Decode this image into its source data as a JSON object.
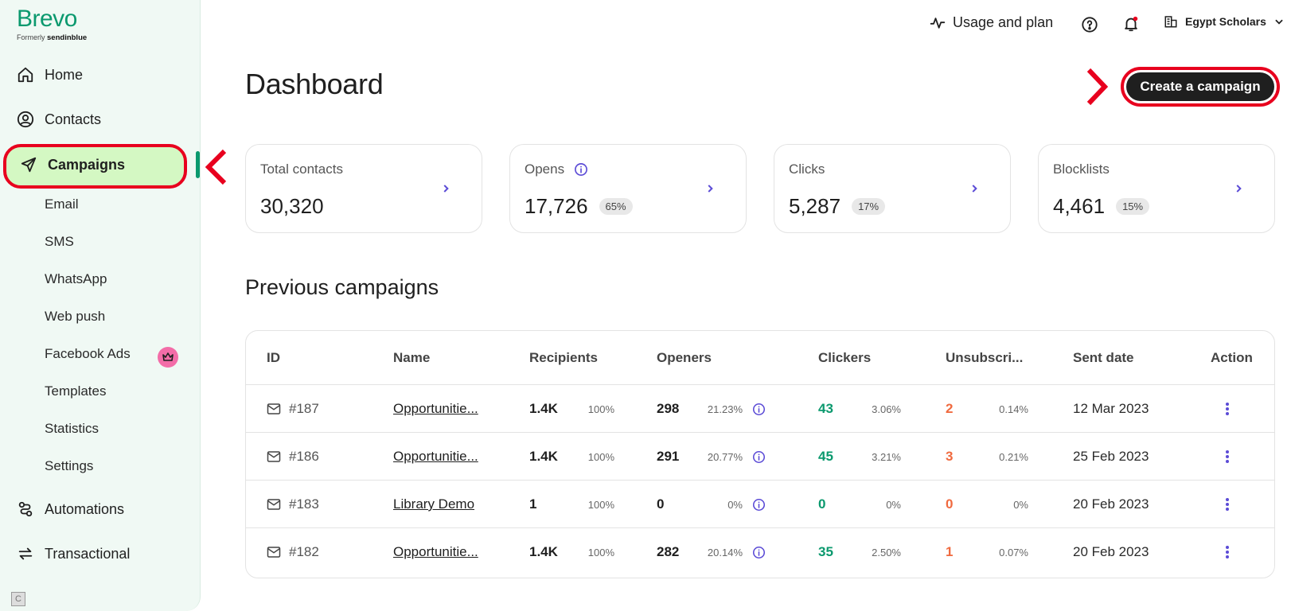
{
  "brand": {
    "logo": "Brevo",
    "formerly_prefix": "Formerly",
    "formerly_name": "sendinblue"
  },
  "colors": {
    "brand_green": "#0b996e",
    "active_bg": "#d4f8c3",
    "highlight_red": "#e8001e",
    "accent_purple": "#5b4bd6",
    "orange": "#f06a3f"
  },
  "sidebar": {
    "home": "Home",
    "contacts": "Contacts",
    "campaigns": "Campaigns",
    "sub": [
      "Email",
      "SMS",
      "WhatsApp",
      "Web push",
      "Facebook Ads",
      "Templates",
      "Statistics",
      "Settings"
    ],
    "automations": "Automations",
    "transactional": "Transactional"
  },
  "topbar": {
    "usage": "Usage and plan",
    "org": "Egypt Scholars"
  },
  "page": {
    "title": "Dashboard",
    "create_button": "Create a campaign"
  },
  "stats": [
    {
      "label": "Total contacts",
      "value": "30,320",
      "pct": ""
    },
    {
      "label": "Opens",
      "value": "17,726",
      "pct": "65%"
    },
    {
      "label": "Clicks",
      "value": "5,287",
      "pct": "17%"
    },
    {
      "label": "Blocklists",
      "value": "4,461",
      "pct": "15%"
    }
  ],
  "campaigns": {
    "title": "Previous campaigns",
    "headers": [
      "ID",
      "Name",
      "Recipients",
      "Openers",
      "Clickers",
      "Unsubscri...",
      "Sent date",
      "Action"
    ],
    "rows": [
      {
        "id": "#187",
        "name": "Opportunitie...",
        "recipients": "1.4K",
        "recipients_pct": "100%",
        "openers": "298",
        "openers_pct": "21.23%",
        "clickers": "43",
        "clickers_pct": "3.06%",
        "unsub": "2",
        "unsub_pct": "0.14%",
        "date": "12 Mar 2023"
      },
      {
        "id": "#186",
        "name": "Opportunitie...",
        "recipients": "1.4K",
        "recipients_pct": "100%",
        "openers": "291",
        "openers_pct": "20.77%",
        "clickers": "45",
        "clickers_pct": "3.21%",
        "unsub": "3",
        "unsub_pct": "0.21%",
        "date": "25 Feb 2023"
      },
      {
        "id": "#183",
        "name": "Library Demo",
        "recipients": "1",
        "recipients_pct": "100%",
        "openers": "0",
        "openers_pct": "0%",
        "clickers": "0",
        "clickers_pct": "0%",
        "unsub": "0",
        "unsub_pct": "0%",
        "date": "20 Feb 2023"
      },
      {
        "id": "#182",
        "name": "Opportunitie...",
        "recipients": "1.4K",
        "recipients_pct": "100%",
        "openers": "282",
        "openers_pct": "20.14%",
        "clickers": "35",
        "clickers_pct": "2.50%",
        "unsub": "1",
        "unsub_pct": "0.07%",
        "date": "20 Feb 2023"
      }
    ]
  }
}
